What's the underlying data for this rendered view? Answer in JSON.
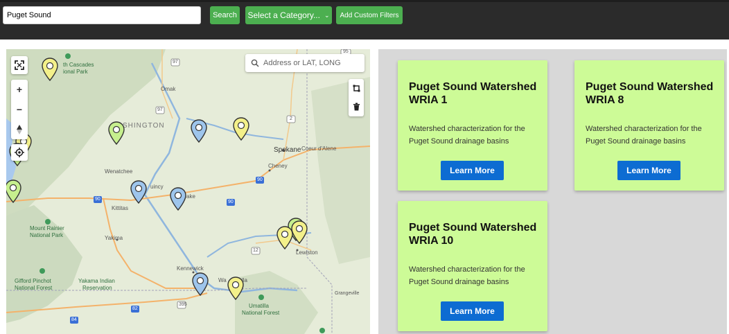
{
  "toolbar": {
    "search_value": "Puget Sound",
    "search_label": "Search",
    "category_label": "Select a Category...",
    "filters_label": "Add Custom Filters",
    "accent_color": "#4caf50"
  },
  "map": {
    "geocoder_placeholder": "Address or LAT, LONG",
    "controls": [
      "fullscreen-icon",
      "zoom-in-icon",
      "zoom-out-icon",
      "compass-icon",
      "locate-icon",
      "draw-polygon-icon",
      "trash-icon"
    ],
    "zoom_in": "+",
    "zoom_out": "−",
    "labels": {
      "north_cascades_1": "th Cascades",
      "north_cascades_2": "ional Park",
      "omak": "Omak",
      "washington": "SHINGTON",
      "wenatchee": "Wenatchee",
      "quincy": "uincy",
      "lake": "ake",
      "kittitas": "Kittitas",
      "spokane": "Spokane",
      "coeur": "Coeur d'Alene",
      "cheney": "Cheney",
      "rainier_1": "Mount Rainier",
      "rainier_2": "National Park",
      "yakima": "Yakima",
      "kennewick": "Kennewick",
      "walla": "Wa",
      "walla2": "lla",
      "lewiston": "Lewiston",
      "pinchot_1": "Gifford Pinchot",
      "pinchot_2": "National Forest",
      "yakama_1": "Yakama Indian",
      "yakama_2": "Reservation",
      "umatilla_1": "Umatilla",
      "umatilla_2": "National Forest",
      "grangeville": "Grangeville",
      "shield_97": "97",
      "shield_97b": "97",
      "shield_2": "2",
      "shield_90": "90",
      "shield_90b": "90",
      "shield_90c": "90",
      "shield_12": "12",
      "shield_82": "82",
      "shield_84": "84",
      "shield_84b": "84",
      "shield_395": "395",
      "shield_top": "95"
    },
    "marker_colors": {
      "yellow": "#f3f08a",
      "green": "#c6ef8e",
      "blue": "#9ec5ec"
    }
  },
  "cards": [
    {
      "title": "Puget Sound Watershed WRIA 1",
      "description": "Watershed characterization for the Puget Sound drainage basins",
      "button": "Learn More"
    },
    {
      "title": "Puget Sound Watershed WRIA 8",
      "description": "Watershed characterization for the Puget Sound drainage basins",
      "button": "Learn More"
    },
    {
      "title": "Puget Sound Watershed WRIA 10",
      "description": "Watershed characterization for the Puget Sound drainage basins",
      "button": "Learn More"
    }
  ],
  "colors": {
    "card_bg": "#cdfb97",
    "button_blue": "#0d6cd2",
    "panel_bg": "#d8d8d8"
  }
}
